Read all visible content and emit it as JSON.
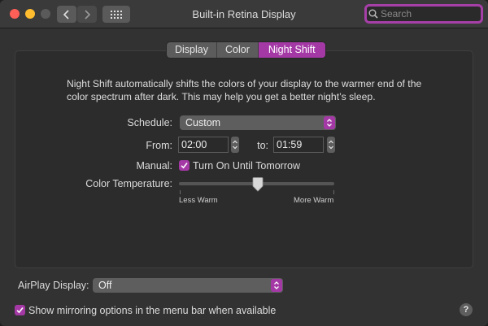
{
  "window": {
    "title": "Built-in Retina Display",
    "search_placeholder": "Search"
  },
  "tabs": [
    {
      "label": "Display",
      "active": false
    },
    {
      "label": "Color",
      "active": false
    },
    {
      "label": "Night Shift",
      "active": true
    }
  ],
  "night_shift": {
    "description": "Night Shift automatically shifts the colors of your display to the warmer end of the color spectrum after dark. This may help you get a better night’s sleep.",
    "schedule_label": "Schedule:",
    "schedule_value": "Custom",
    "from_label": "From:",
    "from_value": "02:00",
    "to_label": "to:",
    "to_value": "01:59",
    "manual_label": "Manual:",
    "manual_checkbox_label": "Turn On Until Tomorrow",
    "manual_checked": true,
    "color_temp_label": "Color Temperature:",
    "color_temp_min_label": "Less Warm",
    "color_temp_max_label": "More Warm",
    "color_temp_level": 0.5
  },
  "bottom": {
    "airplay_label": "AirPlay Display:",
    "airplay_value": "Off",
    "mirroring_label": "Show mirroring options in the menu bar when available",
    "mirroring_checked": true,
    "help_label": "?"
  },
  "colors": {
    "accent": "#a439a6",
    "close": "#fe5f57",
    "minimize": "#febc2e",
    "background": "#323232"
  },
  "icons": [
    "search-icon",
    "chevron-left-icon",
    "chevron-right-icon",
    "grid-icon",
    "updown-arrows-icon",
    "checkmark-icon",
    "help-icon"
  ]
}
